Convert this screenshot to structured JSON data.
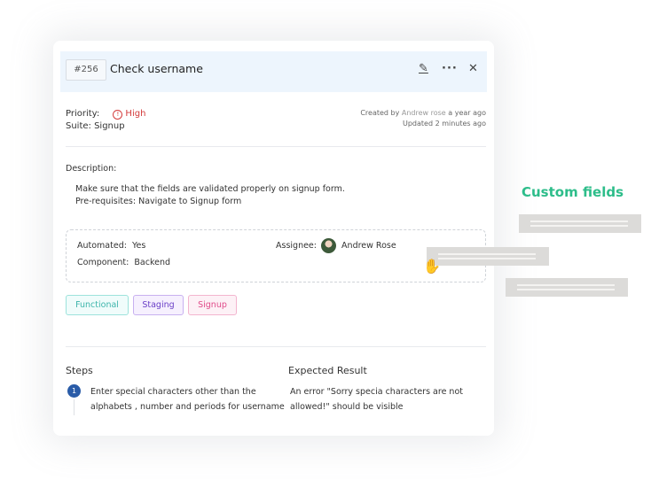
{
  "header": {
    "id": "#256",
    "title": "Check username",
    "icons": [
      "edit-icon",
      "more-icon",
      "close-icon"
    ],
    "edit_glyph": "✎",
    "more_glyph": "···",
    "close_glyph": "✕"
  },
  "meta": {
    "priority_label": "Priority:",
    "priority_icon": "!",
    "priority_value": "High",
    "suite": "Suite: Signup",
    "created_prefix": "Created by ",
    "created_author": "Andrew rose",
    "created_suffix": " a year ago",
    "updated": "Updated 2 minutes ago"
  },
  "description": {
    "label": "Description:",
    "line1": "Make sure that the fields are validated properly on signup form.",
    "line2": "Pre-requisites: Navigate to Signup form"
  },
  "fields": {
    "automated_label": "Automated:",
    "automated_value": "Yes",
    "component_label": "Component:",
    "component_value": "Backend",
    "assignee_label": "Assignee:",
    "assignee_value": "Andrew Rose"
  },
  "tags": [
    "Functional",
    "Staging",
    "Signup"
  ],
  "steps": {
    "steps_header": "Steps",
    "expected_header": "Expected Result",
    "items": [
      {
        "number": "1",
        "step_line1": "Enter special characters other than the",
        "step_line2": "alphabets , number and periods for username",
        "expected_line1": "An error \"Sorry specia characters are not",
        "expected_line2": "allowed!\" should be visible"
      }
    ]
  },
  "custom_fields": {
    "title": "Custom fields"
  },
  "cursor": "✋",
  "colors": {
    "header_bg": "#edf5fd",
    "priority_high": "#d33a3a",
    "accent_green": "#2dbd8a",
    "step_badge": "#2a5ca8"
  }
}
